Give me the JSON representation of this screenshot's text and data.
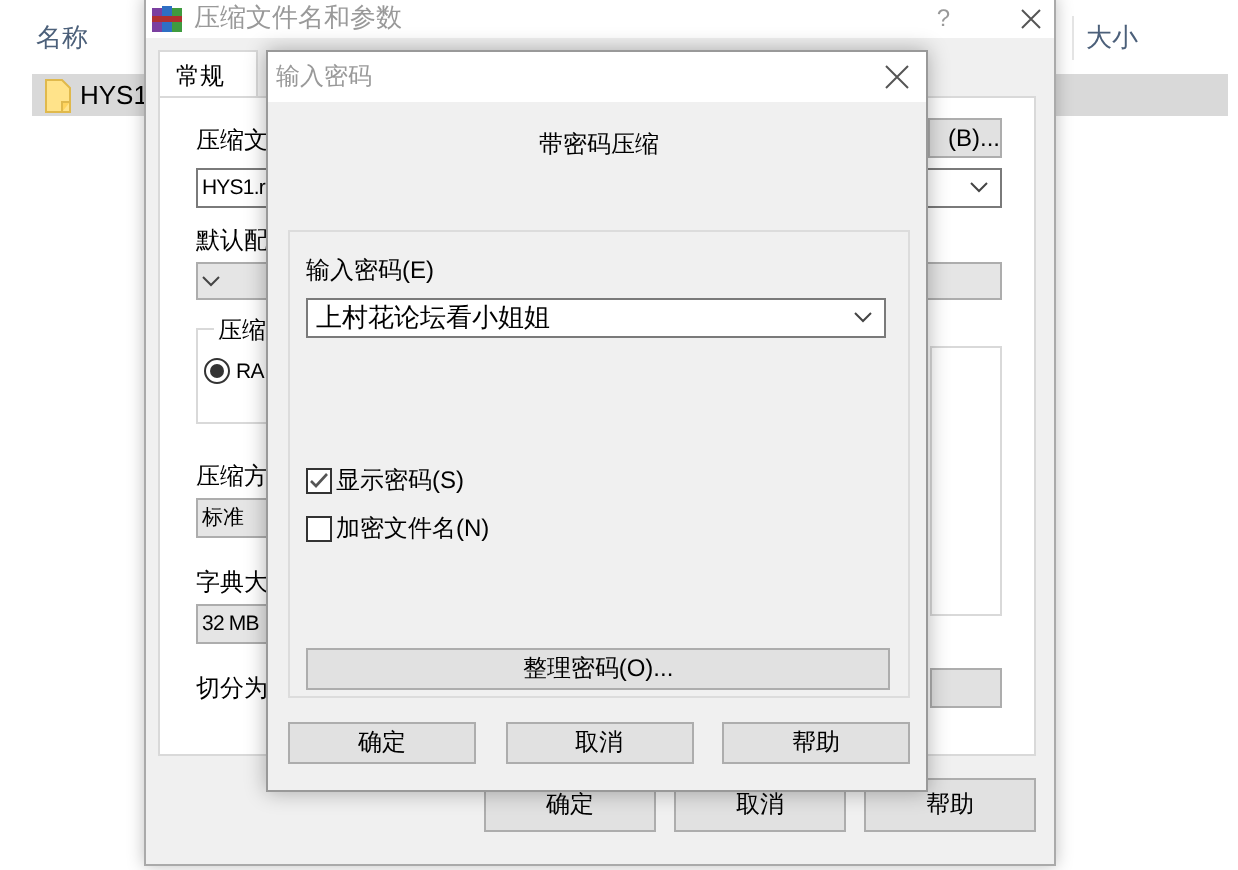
{
  "explorer": {
    "columns": [
      {
        "label": "名称"
      },
      {
        "label": "大小"
      }
    ],
    "rows": [
      {
        "name": "HYS1",
        "selected": true
      }
    ]
  },
  "archive_dialog": {
    "title": "压缩文件名和参数",
    "help": "?",
    "tabs": [
      {
        "label": "常规",
        "selected": true
      }
    ],
    "archive_label": "压缩文",
    "browse_button": "(B)...",
    "archive_name": "HYS1.r",
    "profile_label": "默认配",
    "format_group": {
      "label": "压缩",
      "options": [
        {
          "label": "RA",
          "selected": true
        }
      ]
    },
    "method_label": "压缩方",
    "method_value": "标准",
    "dictionary_label": "字典大",
    "dictionary_value": "32 MB",
    "split_label": "切分为",
    "buttons": [
      "确定",
      "取消",
      "帮助"
    ]
  },
  "password_dialog": {
    "title": "输入密码",
    "heading": "带密码压缩",
    "password_label": "输入密码(E)",
    "password_value": "上村花论坛看小姐姐",
    "checkboxes": [
      {
        "label": "显示密码(S)",
        "checked": true
      },
      {
        "label": "加密文件名(N)",
        "checked": false
      }
    ],
    "organize_button": "整理密码(O)...",
    "buttons": [
      "确定",
      "取消",
      "帮助"
    ]
  }
}
